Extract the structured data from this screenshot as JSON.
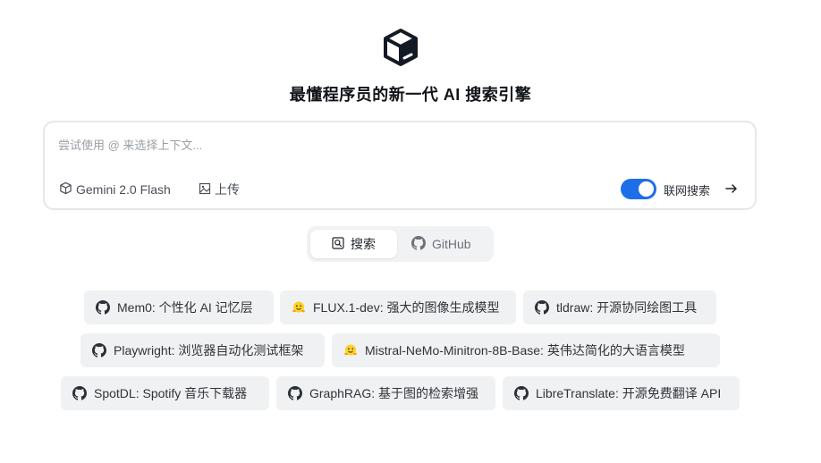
{
  "header": {
    "logo_icon": "box-icon",
    "title": "最懂程序员的新一代 AI 搜索引擎"
  },
  "search": {
    "placeholder": "尝试使用 @ 来选择上下文...",
    "model_label": "Gemini 2.0 Flash",
    "upload_label": "上传",
    "web_search_label": "联网搜索",
    "web_search_enabled": true,
    "accent_color": "#1d6fe8"
  },
  "tabs": {
    "search_label": "搜索",
    "github_label": "GitHub",
    "active": "搜索"
  },
  "suggestions": [
    {
      "icon": "github-icon",
      "label": "Mem0: 个性化 AI 记忆层"
    },
    {
      "icon": "hugging-face-icon",
      "label": "FLUX.1-dev: 强大的图像生成模型"
    },
    {
      "icon": "github-icon",
      "label": "tldraw: 开源协同绘图工具"
    },
    {
      "icon": "github-icon",
      "label": "Playwright: 浏览器自动化测试框架"
    },
    {
      "icon": "hugging-face-icon",
      "label": "Mistral-NeMo-Minitron-8B-Base: 英伟达简化的大语言模型"
    },
    {
      "icon": "github-icon",
      "label": "SpotDL: Spotify 音乐下载器"
    },
    {
      "icon": "github-icon",
      "label": "GraphRAG: 基于图的检索增强"
    },
    {
      "icon": "github-icon",
      "label": "LibreTranslate: 开源免费翻译 API"
    }
  ]
}
